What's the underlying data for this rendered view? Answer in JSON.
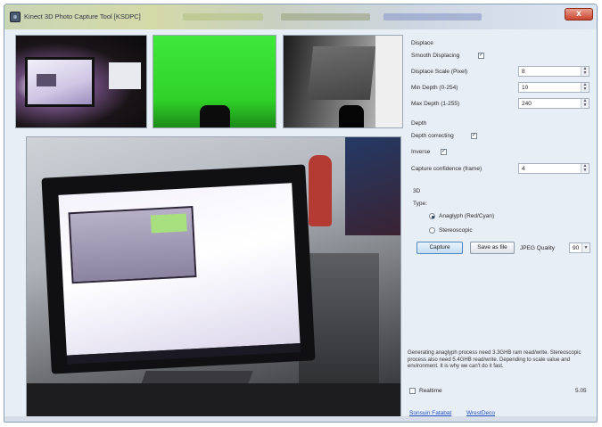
{
  "window": {
    "title": "Kinect 3D Photo Capture Tool [KSDPC]",
    "close_label": "x",
    "accent": "#c9432e"
  },
  "panel": {
    "displace": {
      "header": "Displace",
      "smooth_label": "Smooth Displacing",
      "smooth_checked": true,
      "scale_label": "Displace Scale (Pixel)",
      "scale_value": "8",
      "min_depth_label": "Min Depth (0-254)",
      "min_depth_value": "10",
      "max_depth_label": "Max Depth (1-255)",
      "max_depth_value": "240"
    },
    "depth": {
      "header": "Depth",
      "correcting_label": "Depth correcting",
      "correcting_checked": true,
      "inverse_label": "Inverse",
      "inverse_checked": true,
      "confidence_label": "Capture confidence (frame)",
      "confidence_value": "4"
    },
    "threed": {
      "header": "3D",
      "type_label": "Type:",
      "anaglyph_label": "Anaglyph (Red/Cyan)",
      "anaglyph_selected": true,
      "stereoscopic_label": "Stereoscopic",
      "stereoscopic_selected": false
    },
    "actions": {
      "capture_label": "Capture",
      "save_label": "Save as file",
      "jpeg_label": "JPEG Quality",
      "jpeg_value": "90"
    },
    "info_text": "Generating anaglyph process need 3.3GHB ram read/write. Stereoscopic process also need 5.4GHB read/write. Depending to scale value and environment. It is why we can't do it fast.",
    "realtime_label": "Realtime",
    "realtime_checked": false,
    "fps_value": "5.05",
    "links": {
      "facebook": "Sonsuin Fatabat",
      "blog": "WrestDeco"
    }
  },
  "icons": {
    "app": "app-window-icon",
    "check": "check-icon",
    "spin": "spin-arrows-icon",
    "dropdown": "chevron-down-icon"
  }
}
